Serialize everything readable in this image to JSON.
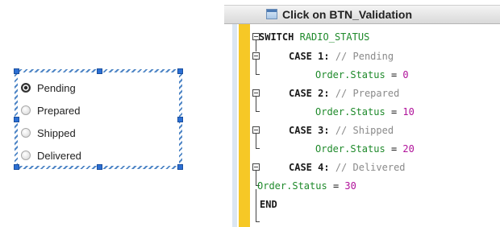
{
  "radio_group": {
    "options": [
      {
        "label": "Pending",
        "checked": true
      },
      {
        "label": "Prepared",
        "checked": false
      },
      {
        "label": "Shipped",
        "checked": false
      },
      {
        "label": "Delivered",
        "checked": false
      }
    ]
  },
  "editor": {
    "title": "Click on BTN_Validation",
    "code": {
      "switch_kw": "SWITCH",
      "switch_var": "RADIO_STATUS",
      "case_kw": "CASE",
      "cases": [
        {
          "value": "1:",
          "comment": "// Pending",
          "target": "Order.Status",
          "op": "=",
          "assign": "0"
        },
        {
          "value": "2:",
          "comment": "// Prepared",
          "target": "Order.Status",
          "op": "=",
          "assign": "10"
        },
        {
          "value": "3:",
          "comment": "// Shipped",
          "target": "Order.Status",
          "op": "=",
          "assign": "20"
        },
        {
          "value": "4:",
          "comment": "// Delivered",
          "target": "Order.Status",
          "op": "=",
          "assign": "30"
        }
      ],
      "end_kw": "END"
    }
  },
  "colors": {
    "keyword": "#1a1a1a",
    "identifier": "#1f8a2b",
    "number": "#b0119a",
    "comment": "#8a8a8a",
    "gutter_accent": "#f6c826"
  }
}
